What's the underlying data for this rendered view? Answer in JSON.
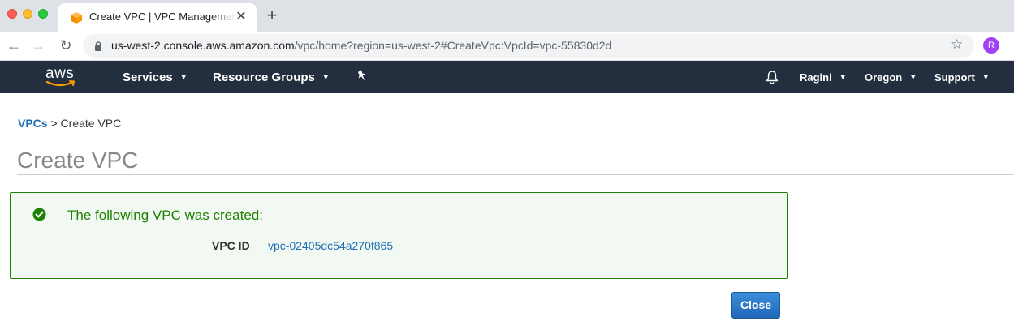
{
  "browser": {
    "tab_title": "Create VPC | VPC Management Console",
    "tab_close": "✕",
    "new_tab": "+",
    "url_host": "us-west-2.console.aws.amazon.com",
    "url_path": "/vpc/home?region=us-west-2#CreateVpc:VpcId=vpc-55830d2d",
    "profile_initial": "R"
  },
  "nav": {
    "logo_text": "aws",
    "services": "Services",
    "resource_groups": "Resource Groups",
    "user": "Ragini",
    "region": "Oregon",
    "support": "Support"
  },
  "breadcrumb": {
    "parent": "VPCs",
    "separator": ">",
    "current": "Create VPC"
  },
  "page": {
    "title": "Create VPC"
  },
  "alert": {
    "message": "The following VPC was created:",
    "field_label": "VPC ID",
    "field_value": "vpc-02405dc54a270f865"
  },
  "actions": {
    "close_label": "Close"
  },
  "colors": {
    "aws_nav_bg": "#232f3e",
    "aws_orange": "#ff9900",
    "success_green": "#1d8102",
    "link_blue": "#1f6fb5",
    "primary_button": "#2069b8"
  }
}
